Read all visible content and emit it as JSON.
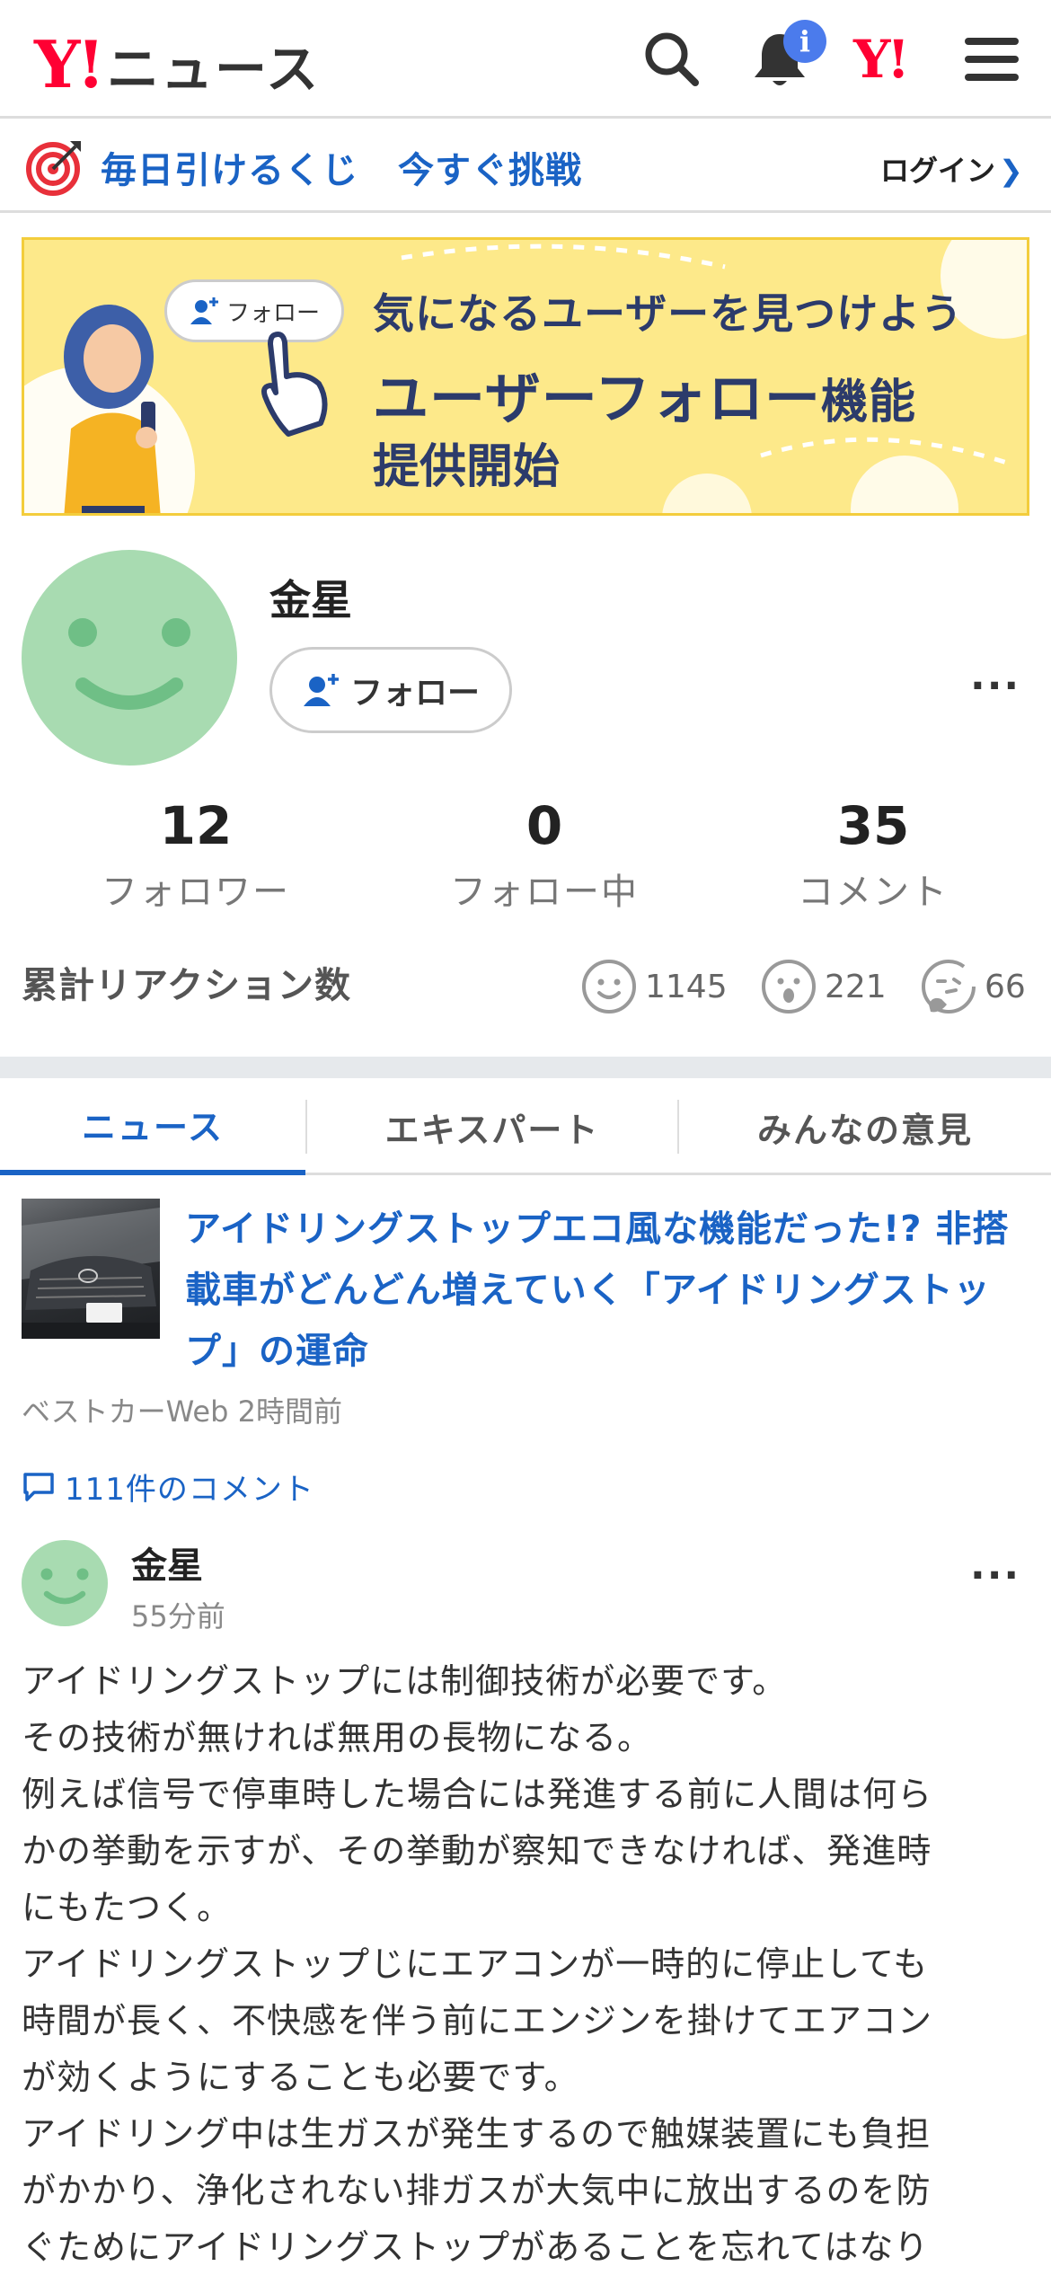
{
  "header": {
    "logo_mark": "Y!",
    "logo_text": "ニュース",
    "notification_badge": "i",
    "yahoo_small": "Y!"
  },
  "lottery": {
    "text1": "毎日引けるくじ",
    "text2": "今すぐ挑戦",
    "login": "ログイン"
  },
  "banner": {
    "pill_label": "フォロー",
    "line1": "気になるユーザーを見つけよう",
    "line2_main": "ユーザーフォロー",
    "line2_small": "機能",
    "line3": "提供開始"
  },
  "profile": {
    "name": "金星",
    "follow_label": "フォロー",
    "avatar_color": "#a8dbb1"
  },
  "stats": [
    {
      "value": "12",
      "label": "フォロワー"
    },
    {
      "value": "0",
      "label": "フォロー中"
    },
    {
      "value": "35",
      "label": "コメント"
    }
  ],
  "reactions": {
    "title": "累計リアクション数",
    "items": [
      {
        "icon": "smile-reaction-icon",
        "count": "1145"
      },
      {
        "icon": "surprised-reaction-icon",
        "count": "221"
      },
      {
        "icon": "thinking-reaction-icon",
        "count": "66"
      }
    ]
  },
  "tabs": [
    {
      "label": "ニュース",
      "active": true
    },
    {
      "label": "エキスパート",
      "active": false
    },
    {
      "label": "みんなの意見",
      "active": false
    }
  ],
  "article": {
    "title": "アイドリングストップエコ風な機能だった!? 非搭載車がどんどん増えていく「アイドリングストップ」の運命",
    "source": "ベストカーWeb",
    "time": "2時間前",
    "comments": "111件のコメント"
  },
  "comment": {
    "user": "金星",
    "time": "55分前",
    "lines": [
      "アイドリングストップには制御技術が必要です。",
      "その技術が無ければ無用の長物になる。",
      "例えば信号で停車時した場合には発進する前に人間は何ら",
      "かの挙動を示すが、その挙動が察知できなければ、発進時",
      "にもたつく。",
      "アイドリングストップじにエアコンが一時的に停止しても",
      "時間が長く、不快感を伴う前にエンジンを掛けてエアコン",
      "が効くようにすることも必要です。",
      "アイドリング中は生ガスが発生するので触媒装置にも負担",
      "がかかり、浄化されない排ガスが大気中に放出するのを防",
      "ぐためにアイドリングストップがあることを忘れてはなり"
    ]
  },
  "colors": {
    "brand_red": "#ff0033",
    "link_blue": "#1a63c5",
    "banner_yellow": "#fde98a"
  }
}
